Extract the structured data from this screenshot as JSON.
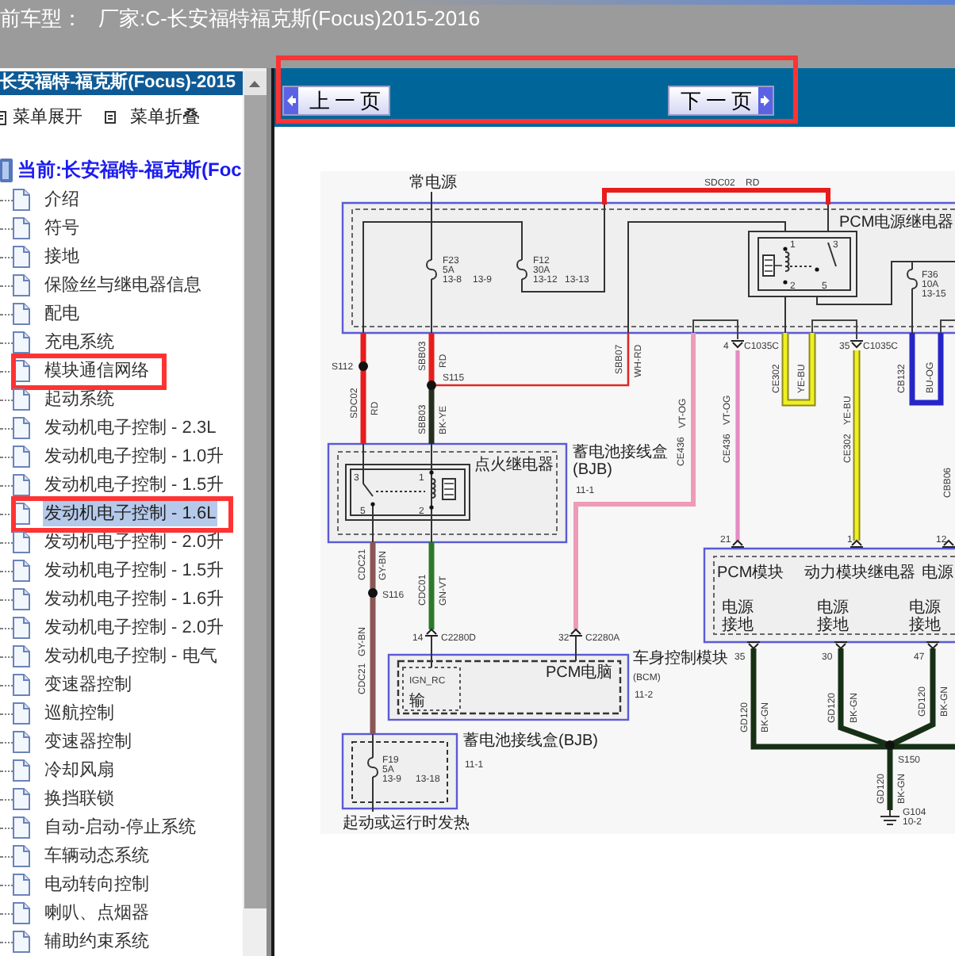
{
  "header": {
    "label": "前车型：",
    "model": "厂家:C-长安福特福克斯(Focus)2015-2016"
  },
  "sidebar": {
    "title": "长安福特-福克斯(Focus)-2015",
    "menu_actions": [
      {
        "label": "菜单展开",
        "kind": "expand"
      },
      {
        "label": "菜单折叠",
        "kind": "collapse"
      }
    ],
    "tree": {
      "label": "当前:长安福特-福克斯(Foc",
      "children": [
        {
          "label": "介绍",
          "selected": false,
          "annotated": false
        },
        {
          "label": "符号",
          "selected": false,
          "annotated": false
        },
        {
          "label": "接地",
          "selected": false,
          "annotated": false
        },
        {
          "label": "保险丝与继电器信息",
          "selected": false,
          "annotated": false
        },
        {
          "label": "配电",
          "selected": false,
          "annotated": false
        },
        {
          "label": "充电系统",
          "selected": false,
          "annotated": false
        },
        {
          "label": "模块通信网络",
          "selected": false,
          "annotated": true
        },
        {
          "label": "起动系统",
          "selected": false,
          "annotated": false
        },
        {
          "label": "发动机电子控制 - 2.3L",
          "selected": false,
          "annotated": false
        },
        {
          "label": "发动机电子控制 - 1.0升",
          "selected": false,
          "annotated": false
        },
        {
          "label": "发动机电子控制 - 1.5升",
          "selected": false,
          "annotated": false
        },
        {
          "label": "发动机电子控制 - 1.6L",
          "selected": true,
          "annotated": true
        },
        {
          "label": "发动机电子控制 - 2.0升",
          "selected": false,
          "annotated": false
        },
        {
          "label": "发动机电子控制 - 1.5升",
          "selected": false,
          "annotated": false
        },
        {
          "label": "发动机电子控制 - 1.6升",
          "selected": false,
          "annotated": false
        },
        {
          "label": "发动机电子控制 - 2.0升",
          "selected": false,
          "annotated": false
        },
        {
          "label": "发动机电子控制 - 电气",
          "selected": false,
          "annotated": false
        },
        {
          "label": "变速器控制",
          "selected": false,
          "annotated": false
        },
        {
          "label": "巡航控制",
          "selected": false,
          "annotated": false
        },
        {
          "label": "变速器控制",
          "selected": false,
          "annotated": false
        },
        {
          "label": "冷却风扇",
          "selected": false,
          "annotated": false
        },
        {
          "label": "换挡联锁",
          "selected": false,
          "annotated": false
        },
        {
          "label": "自动-启动-停止系统",
          "selected": false,
          "annotated": false
        },
        {
          "label": "车辆动态系统",
          "selected": false,
          "annotated": false
        },
        {
          "label": "电动转向控制",
          "selected": false,
          "annotated": false
        },
        {
          "label": "喇叭、点烟器",
          "selected": false,
          "annotated": false
        },
        {
          "label": "辅助约束系统",
          "selected": false,
          "annotated": false
        }
      ]
    }
  },
  "toolbar": {
    "annotated": true,
    "buttons": [
      {
        "label": "上一页",
        "kind": "previous"
      },
      {
        "label": "下一页",
        "kind": "next"
      }
    ]
  },
  "wiring_diagram": {
    "labels": [
      "常电源",
      "SDC02",
      "RD",
      "F23",
      "5A",
      "13-8",
      "13-9",
      "F12",
      "30A",
      "13-12",
      "13-13",
      "PCM电源继电器",
      "1",
      "3",
      "2",
      "5",
      "F36",
      "10A",
      "13-15",
      "4",
      "C1035C",
      "35",
      "C1035C",
      "S112",
      "SBB03",
      "RD",
      "S115",
      "SBB07",
      "WH-RD",
      "CE302",
      "YE-BU",
      "CB132",
      "BU-OG",
      "SDC02",
      "RD",
      "SBB03",
      "BK-YE",
      "CE436",
      "VT-OG",
      "CE436",
      "VT-OG",
      "YE-BU",
      "CE302",
      "CBB06",
      "蓄电池接线盒(BJB)",
      "11-1",
      "点火继电器",
      "3",
      "1",
      "5",
      "2",
      "CDC21",
      "GY-BN",
      "S116",
      "CDC01",
      "GN-VT",
      "GY-BN",
      "CDC21",
      "14",
      "C2280D",
      "32",
      "C2280A",
      "车身控制模块",
      "(BCM)",
      "11-2",
      "IGN_RC",
      "输",
      "PCM电脑",
      "蓄电池接线盒(BJB)",
      "11-1",
      "F19",
      "5A",
      "13-9",
      "13-18",
      "起动或运行时发热",
      "21",
      "1",
      "12",
      "PCM模块",
      "动力模块继电器",
      "电源",
      "电源",
      "接地",
      "电源",
      "接地",
      "电源",
      "接地",
      "35",
      "30",
      "47",
      "GD120",
      "BK-GN",
      "GD120",
      "BK-GN",
      "GD120",
      "BK-GN",
      "S150",
      "GD120",
      "BK-GN",
      "G104",
      "10-2"
    ]
  }
}
